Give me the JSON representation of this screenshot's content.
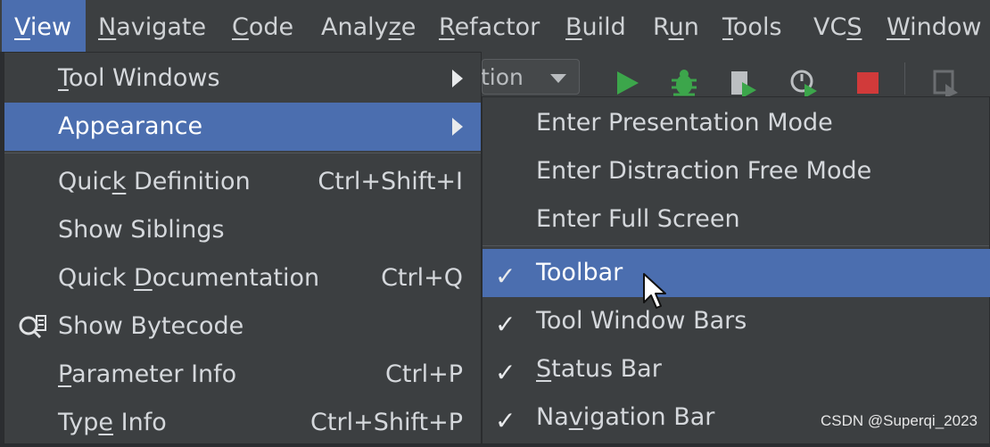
{
  "menubar": {
    "items": [
      {
        "pre": "",
        "ul": "V",
        "post": "iew"
      },
      {
        "pre": "",
        "ul": "N",
        "post": "avigate"
      },
      {
        "pre": "",
        "ul": "C",
        "post": "ode"
      },
      {
        "pre": "Analy",
        "ul": "z",
        "post": "e"
      },
      {
        "pre": "",
        "ul": "R",
        "post": "efactor"
      },
      {
        "pre": "",
        "ul": "B",
        "post": "uild"
      },
      {
        "pre": "R",
        "ul": "u",
        "post": "n"
      },
      {
        "pre": "",
        "ul": "T",
        "post": "ools"
      },
      {
        "pre": "VC",
        "ul": "S",
        "post": ""
      },
      {
        "pre": "",
        "ul": "W",
        "post": "indow"
      }
    ]
  },
  "toolbar": {
    "run_config_text": "tion",
    "icons": [
      "run-icon",
      "debug-icon",
      "coverage-icon",
      "profile-icon",
      "stop-icon",
      "build-project-icon"
    ]
  },
  "view_menu": {
    "items": [
      {
        "pre": "",
        "ul": "T",
        "post": "ool Windows",
        "shortcut": "",
        "submenu": true
      },
      {
        "pre": "Appearance",
        "ul": "",
        "post": "",
        "shortcut": "",
        "submenu": true,
        "highlight": true
      },
      {
        "pre": "Quic",
        "ul": "k",
        "post": " Definition",
        "shortcut": "Ctrl+Shift+I"
      },
      {
        "pre": "Show Siblings",
        "ul": "",
        "post": "",
        "shortcut": ""
      },
      {
        "pre": "Quick ",
        "ul": "D",
        "post": "ocumentation",
        "shortcut": "Ctrl+Q"
      },
      {
        "pre": "Show Bytecode",
        "ul": "",
        "post": "",
        "shortcut": "",
        "icon": "bytecode-icon"
      },
      {
        "pre": "",
        "ul": "P",
        "post": "arameter Info",
        "shortcut": "Ctrl+P"
      },
      {
        "pre": "Typ",
        "ul": "e",
        "post": " Info",
        "shortcut": "Ctrl+Shift+P"
      }
    ]
  },
  "appearance_submenu": {
    "check_glyph": "✓",
    "items": [
      {
        "pre": "Enter Presentation Mode",
        "ul": "",
        "post": "",
        "checked": false
      },
      {
        "pre": "Enter Distraction Free Mode",
        "ul": "",
        "post": "",
        "checked": false
      },
      {
        "pre": "Enter Full Screen",
        "ul": "",
        "post": "",
        "checked": false
      },
      {
        "pre": "Toolbar",
        "ul": "",
        "post": "",
        "checked": true,
        "highlight": true
      },
      {
        "pre": "Tool Window Bars",
        "ul": "",
        "post": "",
        "checked": true
      },
      {
        "pre": "",
        "ul": "S",
        "post": "tatus Bar",
        "checked": true
      },
      {
        "pre": "Na",
        "ul": "v",
        "post": "igation Bar",
        "checked": true
      }
    ]
  },
  "watermark": "CSDN @Superqi_2023",
  "colors": {
    "accent": "#4b6eaf",
    "menu_bg": "#3c3f41",
    "run_green": "#3ca64b",
    "stop_red": "#d13a3a"
  }
}
